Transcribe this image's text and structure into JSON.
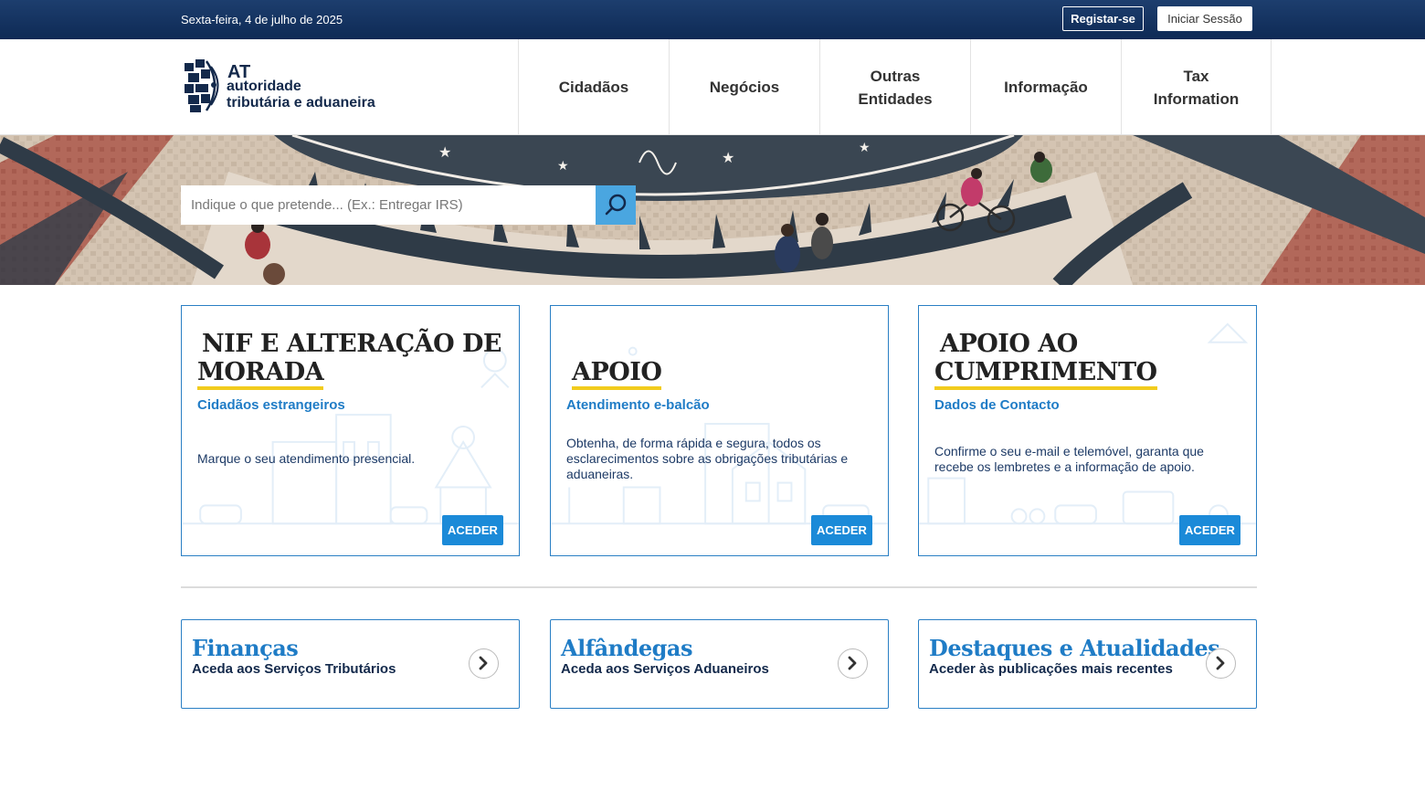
{
  "topbar": {
    "date": "Sexta-feira, 4 de julho de 2025",
    "register_label": "Registar-se",
    "login_label": "Iniciar Sessão"
  },
  "logo": {
    "line1": "AT",
    "line2": "autoridade",
    "line3": "tributária e aduaneira"
  },
  "nav": {
    "items": [
      {
        "label": "Cidadãos"
      },
      {
        "label": "Negócios"
      },
      {
        "label": "Outras Entidades"
      },
      {
        "label": "Informação"
      },
      {
        "label": "Tax Information"
      }
    ]
  },
  "search": {
    "placeholder": "Indique o que pretende... (Ex.: Entregar IRS)",
    "icon": "search-icon"
  },
  "cards": [
    {
      "title_line1": "NIF E ALTERAÇÃO DE",
      "title_line2": "MORADA",
      "subtitle": "Cidadãos estrangeiros",
      "description": "Marque o seu atendimento presencial.",
      "button": "ACEDER"
    },
    {
      "title_line1": "",
      "title_line2": "APOIO",
      "subtitle": "Atendimento e-balcão",
      "description": "Obtenha, de forma rápida e segura, todos os esclarecimentos sobre as obrigações tributárias e aduaneiras.",
      "button": "ACEDER"
    },
    {
      "title_line1": "APOIO AO",
      "title_line2": "CUMPRIMENTO",
      "subtitle": "Dados de Contacto",
      "description": "Confirme o seu e-mail e telemóvel, garanta que recebe os lembretes e a informação de apoio.",
      "button": "ACEDER"
    }
  ],
  "links": [
    {
      "title": "Finanças",
      "subtitle": "Aceda aos Serviços Tributários",
      "icon": "chevron-right-icon"
    },
    {
      "title": "Alfândegas",
      "subtitle": "Aceda aos Serviços Aduaneiros",
      "icon": "chevron-right-icon"
    },
    {
      "title": "Destaques e Atualidades",
      "subtitle": "Aceder às publicações mais recentes",
      "icon": "chevron-right-icon"
    }
  ],
  "colors": {
    "topbar": "#0e2a55",
    "accent_blue": "#1f7cc6",
    "button_blue": "#1b8ad8",
    "underline_yellow": "#f2cc1d",
    "search_button": "#4aa6e0"
  }
}
